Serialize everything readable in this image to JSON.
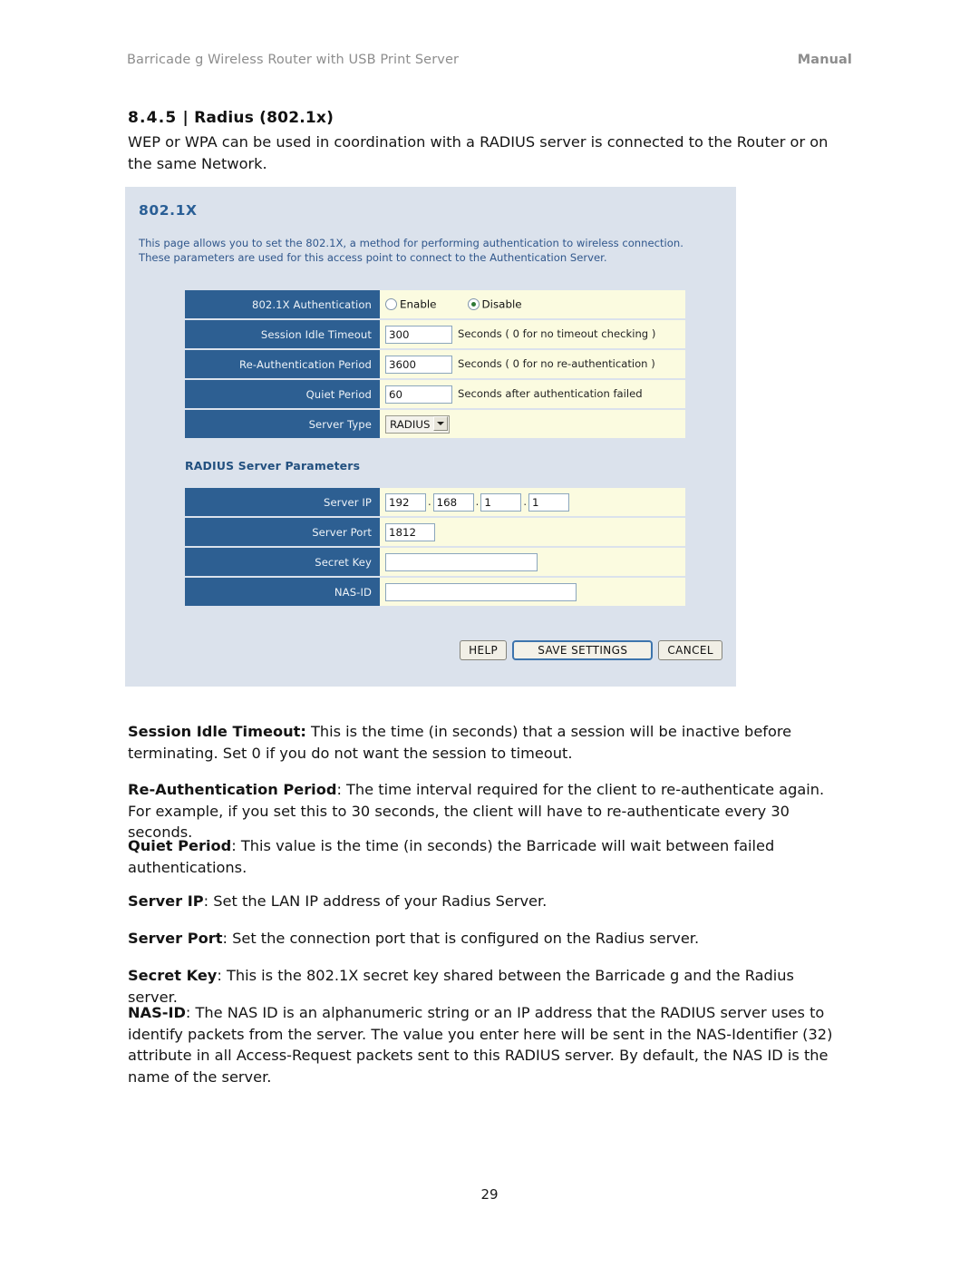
{
  "header": {
    "left": "Barricade g Wireless Router with USB Print Server",
    "right": "Manual"
  },
  "section": {
    "number": "8.4.5",
    "separator": "|",
    "title": "Radius (802.1x)",
    "heading_full": "8.4.5 | Radius (802.1x)",
    "intro": "WEP or WPA can be used in coordination with a RADIUS server is connected to the Router or on the same Network."
  },
  "router_ui": {
    "title": "802.1X",
    "description": "This page allows you to set the 802.1X, a method for performing authentication to wireless connection.  These parameters are used for this access point to connect to the Authentication Server.",
    "colors": {
      "panel_bg": "#dbe2ec",
      "label_bg": "#2d5f92",
      "field_bg": "#fbfbe0",
      "title_blue": "#2a5f96",
      "radio_dot": "#2f7a36",
      "focus_border": "#3d74ad"
    },
    "main_rows": {
      "auth": {
        "label": "802.1X Authentication",
        "enable_label": "Enable",
        "disable_label": "Disable",
        "selected": "Disable"
      },
      "session_idle_timeout": {
        "label": "Session Idle Timeout",
        "value": "300",
        "hint": "Seconds ( 0 for no timeout checking )"
      },
      "reauth_period": {
        "label": "Re-Authentication Period",
        "value": "3600",
        "hint": "Seconds ( 0 for no re-authentication )"
      },
      "quiet_period": {
        "label": "Quiet Period",
        "value": "60",
        "hint": "Seconds after authentication failed"
      },
      "server_type": {
        "label": "Server Type",
        "value": "RADIUS",
        "options": [
          "RADIUS"
        ]
      }
    },
    "radius_section_title": "RADIUS Server Parameters",
    "radius_rows": {
      "server_ip": {
        "label": "Server IP",
        "octet1": "192",
        "octet2": "168",
        "octet3": "1",
        "octet4": "1",
        "separator": "."
      },
      "server_port": {
        "label": "Server Port",
        "value": "1812"
      },
      "secret_key": {
        "label": "Secret Key",
        "value": ""
      },
      "nas_id": {
        "label": "NAS-ID",
        "value": ""
      }
    },
    "buttons": {
      "help": "HELP",
      "save": "SAVE SETTINGS",
      "cancel": "CANCEL"
    }
  },
  "descriptions": {
    "session_idle_timeout": {
      "term": "Session Idle Timeout:",
      "text": " This is the time (in seconds) that a session will be inactive before terminating. Set 0 if you do not want the session to timeout."
    },
    "reauth_period": {
      "term": "Re-Authentication Period",
      "text": ": The time interval required for the client to re-authenticate again. For example, if you set this to 30 seconds, the client will have to re-authenticate every 30 seconds."
    },
    "quiet_period": {
      "term": "Quiet Period",
      "text": ": This value is the time (in seconds) the Barricade will wait between failed authentications."
    },
    "server_ip": {
      "term": "Server IP",
      "text": ": Set the LAN IP address of your Radius Server."
    },
    "server_port": {
      "term": "Server Port",
      "text": ": Set the connection port that is configured on the Radius server."
    },
    "secret_key": {
      "term": "Secret Key",
      "text": ": This is the 802.1X secret key shared between the Barricade g and the Radius server."
    },
    "nas_id": {
      "term": "NAS-ID",
      "text": ": The NAS ID is an alphanumeric string or an IP address that the RADIUS server uses to identify packets from the server. The value you enter here will be sent in the NAS-Identifier (32) attribute in all Access-Request packets sent to this RADIUS server. By default, the NAS ID is the name of the server."
    }
  },
  "page_number": "29"
}
